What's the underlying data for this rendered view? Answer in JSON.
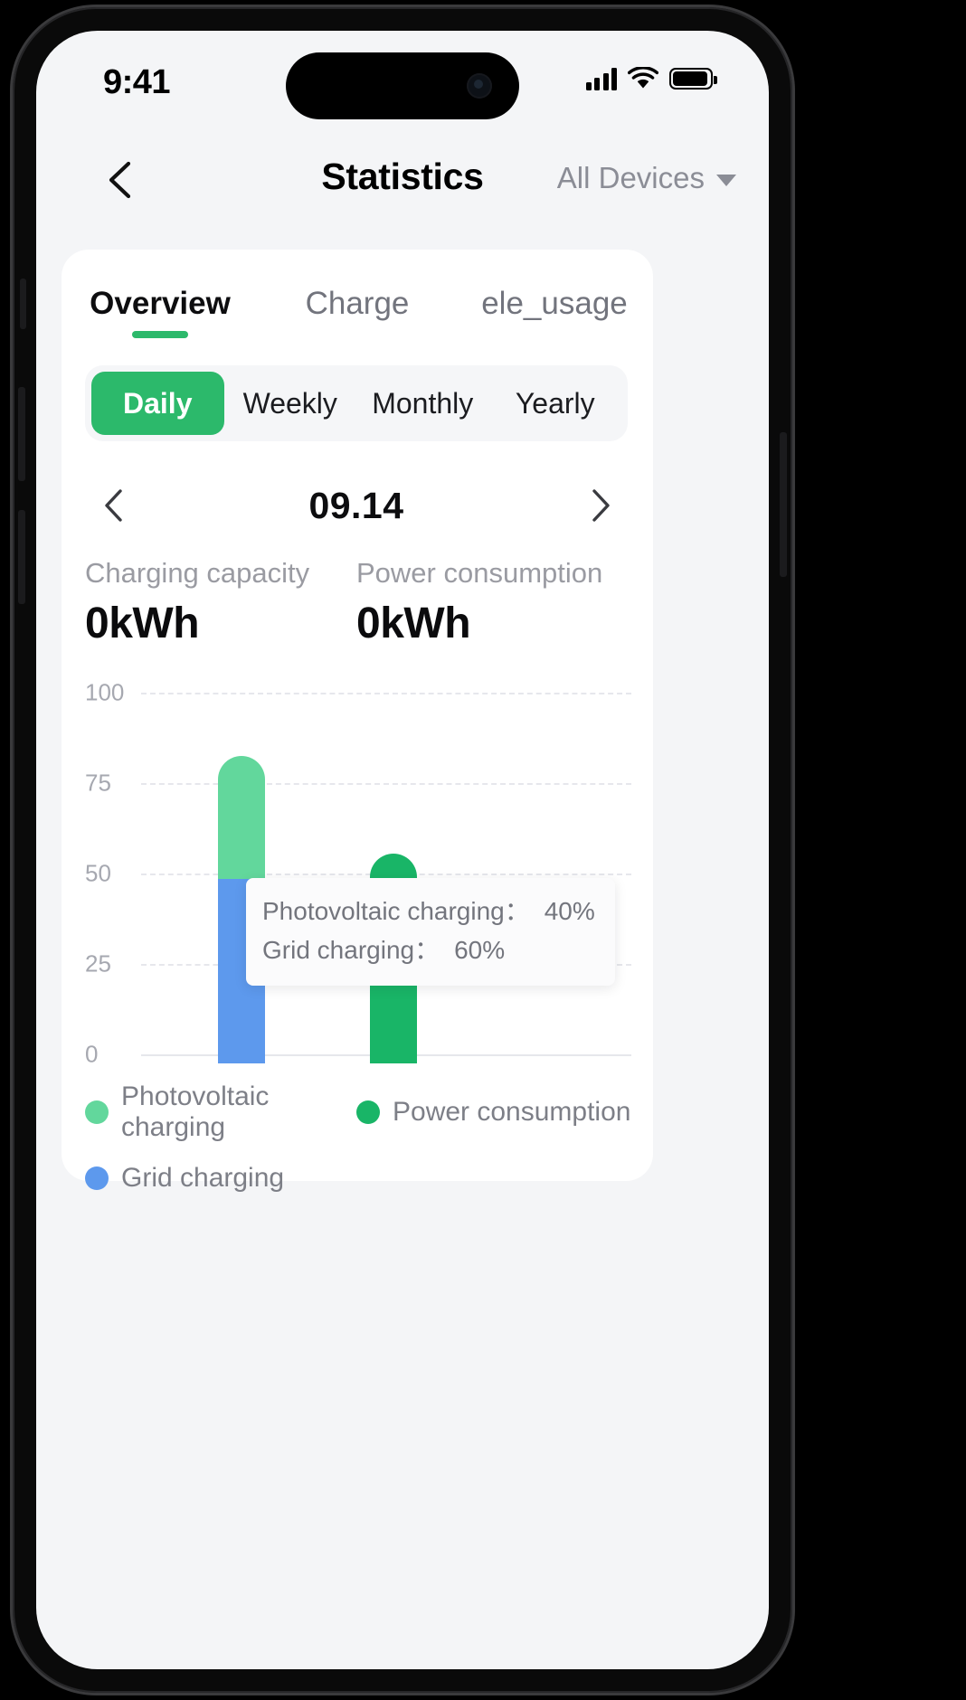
{
  "status_bar": {
    "time": "9:41",
    "signal_icon": "cellular-signal-icon",
    "wifi_icon": "wifi-icon",
    "battery_icon": "battery-full-icon"
  },
  "header": {
    "back_icon": "chevron-left-icon",
    "title": "Statistics",
    "device_filter_label": "All Devices",
    "device_filter_icon": "chevron-down-icon"
  },
  "tabs": [
    {
      "label": "Overview",
      "active": true
    },
    {
      "label": "Charge",
      "active": false
    },
    {
      "label": "ele_usage",
      "active": false
    }
  ],
  "period_segment": [
    {
      "label": "Daily",
      "active": true
    },
    {
      "label": "Weekly",
      "active": false
    },
    {
      "label": "Monthly",
      "active": false
    },
    {
      "label": "Yearly",
      "active": false
    }
  ],
  "date_nav": {
    "prev_icon": "chevron-left-icon",
    "date": "09.14",
    "next_icon": "chevron-right-icon"
  },
  "summary": [
    {
      "label": "Charging capacity",
      "value": "0kWh"
    },
    {
      "label": "Power consumption",
      "value": "0kWh"
    }
  ],
  "tooltip": {
    "rows": [
      {
        "key": "Photovoltaic charging：",
        "value": "40%"
      },
      {
        "key": "Grid charging：",
        "value": "60%"
      }
    ]
  },
  "legend": [
    {
      "label": "Photovoltaic charging",
      "color": "#62d79c"
    },
    {
      "label": "Power consumption",
      "color": "#19b567"
    },
    {
      "label": "Grid charging",
      "color": "#5d99ed"
    }
  ],
  "colors": {
    "accent_green": "#2cb96b",
    "pv_green": "#62d79c",
    "consumption_green": "#19b567",
    "grid_blue": "#5d99ed",
    "screen_bg": "#f4f5f7",
    "card_bg": "#ffffff",
    "muted_text": "#8b8d96"
  },
  "chart_data": {
    "type": "bar",
    "title": "",
    "xlabel": "",
    "ylabel": "",
    "ylim": [
      0,
      100
    ],
    "yticks": [
      0,
      25,
      50,
      75,
      100
    ],
    "ytick_labels": [
      "0",
      "25",
      "50",
      "75",
      "100"
    ],
    "grid": true,
    "stacked": true,
    "legend_position": "bottom-left",
    "categories": [
      "Charging capacity",
      "Power consumption"
    ],
    "series": [
      {
        "name": "Grid charging",
        "color": "#5d99ed",
        "values": [
          51,
          0
        ]
      },
      {
        "name": "Photovoltaic charging",
        "color": "#62d79c",
        "values": [
          34,
          0
        ]
      },
      {
        "name": "Power consumption",
        "color": "#19b567",
        "values": [
          0,
          58
        ]
      }
    ]
  }
}
